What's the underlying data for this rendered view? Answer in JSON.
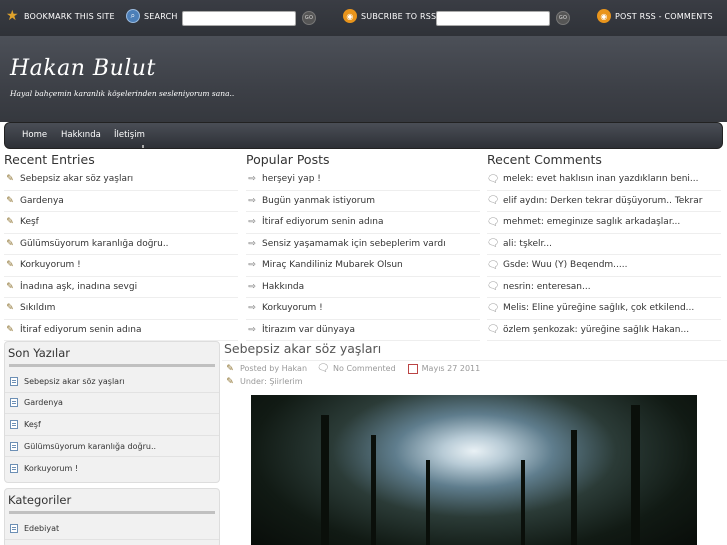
{
  "topbar": {
    "bookmark": "BOOKMARK THIS SITE",
    "search": "SEARCH",
    "go1": "GO",
    "subscribe": "SUBCRIBE TO RSS",
    "go2": "GO",
    "post_rss": "POST RSS - COMMENTS"
  },
  "header": {
    "title": "Hakan Bulut",
    "description": "Hayal bahçemin karanlık köşelerinden sesleniyorum sana.."
  },
  "nav": {
    "items": [
      "Home",
      "Hakkında",
      "İletişim"
    ]
  },
  "recent_entries": {
    "heading": "Recent Entries",
    "items": [
      "Sebepsiz akar söz yaşları",
      "Gardenya",
      "Keşf",
      "Gülümsüyorum karanlığa doğru..",
      "Korkuyorum !",
      "İnadına aşk, inadına sevgi",
      "Sıkıldım",
      "İtiraf ediyorum senin adına"
    ]
  },
  "popular_posts": {
    "heading": "Popular Posts",
    "items": [
      "herşeyi yap !",
      "Bugün yanmak istiyorum",
      "İtiraf ediyorum senin adına",
      "Sensiz yaşamamak için sebeplerim vardı",
      "Miraç Kandiliniz Mubarek Olsun",
      "Hakkında",
      "Korkuyorum !",
      "İtirazım var dünyaya"
    ]
  },
  "recent_comments": {
    "heading": "Recent Comments",
    "items": [
      "melek: evet haklısın inan yazdıkların beni...",
      "elif aydın: Derken tekrar düşüyorum.. Tekrar",
      "mehmet: emeginıze saglık arkadaşlar...",
      "ali: tşkelr...",
      "Gsde: Wuu (Y) Beqendm.....",
      "nesrin: enteresan...",
      "Melis: Eline yüreğine sağlık, çok etkilend...",
      "özlem şenkozak: yüreğine sağlık Hakan..."
    ]
  },
  "sidebar": {
    "son_yazilar": {
      "heading": "Son Yazılar",
      "items": [
        "Sebepsiz akar söz yaşları",
        "Gardenya",
        "Keşf",
        "Gülümsüyorum karanlığa doğru..",
        "Korkuyorum !"
      ]
    },
    "kategoriler": {
      "heading": "Kategoriler",
      "items": [
        "Edebiyat"
      ]
    }
  },
  "post": {
    "title": "Sebepsiz akar söz yaşları",
    "author": "Posted by Hakan",
    "comments": "No Commented",
    "date": "Mayıs 27 2011",
    "category": "Under: Şiirlerim"
  }
}
